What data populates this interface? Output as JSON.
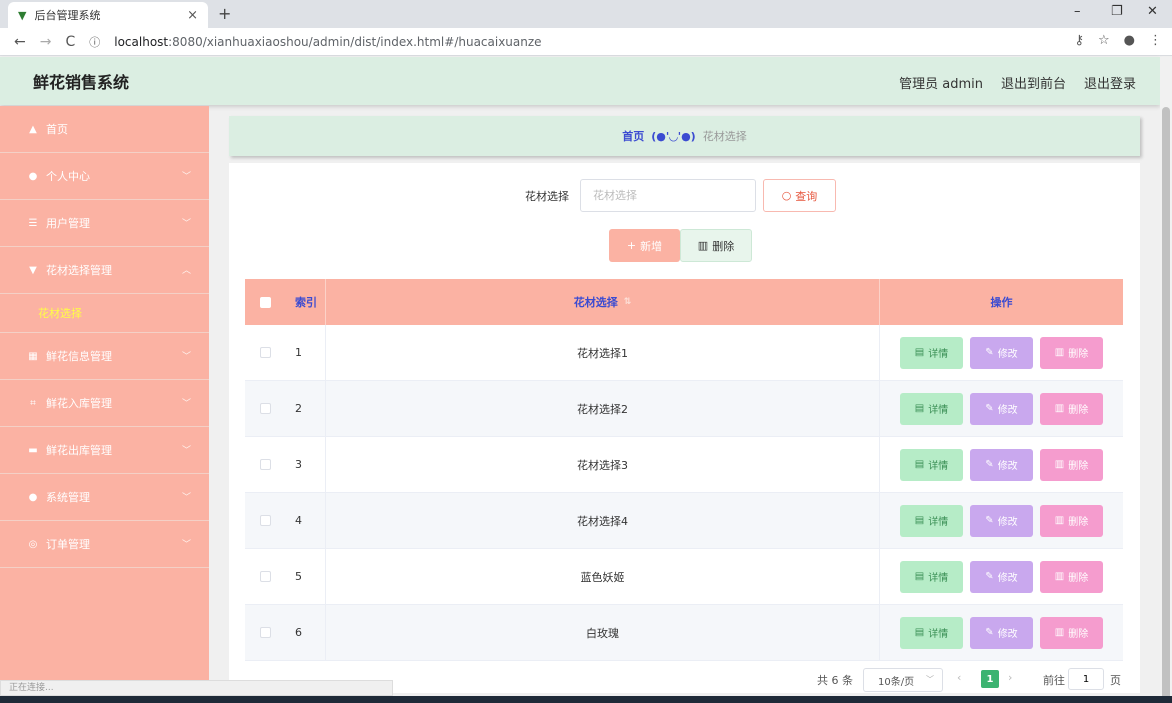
{
  "browser": {
    "tab_title": "后台管理系统",
    "url_host": "localhost",
    "url_rest": ":8080/xianhuaxiaoshou/admin/dist/index.html#/huacaixuanze"
  },
  "header": {
    "title": "鲜花销售系统",
    "user_label": "管理员 admin",
    "to_front": "退出到前台",
    "logout": "退出登录"
  },
  "sidebar": {
    "items": [
      {
        "label": "首页",
        "icon": "home-icon"
      },
      {
        "label": "个人中心",
        "icon": "user-icon"
      },
      {
        "label": "用户管理",
        "icon": "sliders-icon"
      },
      {
        "label": "花材选择管理",
        "icon": "filter-icon"
      },
      {
        "label": "鲜花信息管理",
        "icon": "grid-icon"
      },
      {
        "label": "鲜花入库管理",
        "icon": "crop-icon"
      },
      {
        "label": "鲜花出库管理",
        "icon": "ticket-icon"
      },
      {
        "label": "系统管理",
        "icon": "bulb-icon"
      },
      {
        "label": "订单管理",
        "icon": "globe-icon"
      }
    ],
    "submenu_active": "花材选择"
  },
  "breadcrumb": {
    "home": "首页",
    "emoticon": "(●'◡'●)",
    "current": "花材选择"
  },
  "search": {
    "label": "花材选择",
    "placeholder": "花材选择",
    "button": "查询"
  },
  "actions": {
    "add": "新增",
    "delete": "删除"
  },
  "table": {
    "headers": {
      "index": "索引",
      "name": "花材选择",
      "ops": "操作"
    },
    "rows": [
      {
        "index": "1",
        "name": "花材选择1"
      },
      {
        "index": "2",
        "name": "花材选择2"
      },
      {
        "index": "3",
        "name": "花材选择3"
      },
      {
        "index": "4",
        "name": "花材选择4"
      },
      {
        "index": "5",
        "name": "蓝色妖姬"
      },
      {
        "index": "6",
        "name": "白玫瑰"
      }
    ],
    "op_labels": {
      "detail": "详情",
      "edit": "修改",
      "delete": "删除"
    }
  },
  "pagination": {
    "total": "共 6 条",
    "page_size": "10条/页",
    "current": "1",
    "goto_label": "前往",
    "goto_value": "1",
    "page_suffix": "页"
  },
  "status_bar": "正在连接...",
  "colors": {
    "accent": "#fbb2a3",
    "header_bg": "#dbeee2",
    "link_blue": "#3b4bd1",
    "active_page": "#3cb371"
  }
}
